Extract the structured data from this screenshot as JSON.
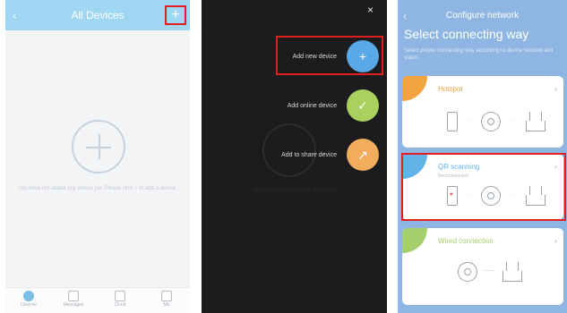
{
  "screen1": {
    "back_glyph": "‹",
    "title": "All Devices",
    "add_glyph": "+",
    "empty_text": "You have not added any device yet. Please click + to add a device.",
    "tabs": [
      {
        "label": "Devices"
      },
      {
        "label": "Messages"
      },
      {
        "label": "Cloud"
      },
      {
        "label": "Me"
      }
    ]
  },
  "screen2": {
    "close_glyph": "×",
    "options": [
      {
        "label": "Add new device",
        "icon": "+"
      },
      {
        "label": "Add online device",
        "icon": "✓"
      },
      {
        "label": "Add to share device",
        "icon": "↗"
      }
    ],
    "dim_text": "You have not added any device yet."
  },
  "screen3": {
    "back_glyph": "‹",
    "title": "Configure network",
    "heading": "Select connecting way",
    "subtext": "Select proper connecting way according to device network and status",
    "methods": [
      {
        "name": "Hotspot",
        "color": "#f2a53f"
      },
      {
        "name": "QR scanning",
        "sub": "Recommended",
        "color": "#64b3e8"
      },
      {
        "name": "Wired connection",
        "color": "#a5cf6a"
      }
    ],
    "chevron": "›"
  },
  "colors": {
    "accent_blue": "#9fd7f3",
    "highlight_red": "#e02020",
    "dark_bg": "#1c1c1e",
    "config_bg": "#8fb6e2"
  }
}
